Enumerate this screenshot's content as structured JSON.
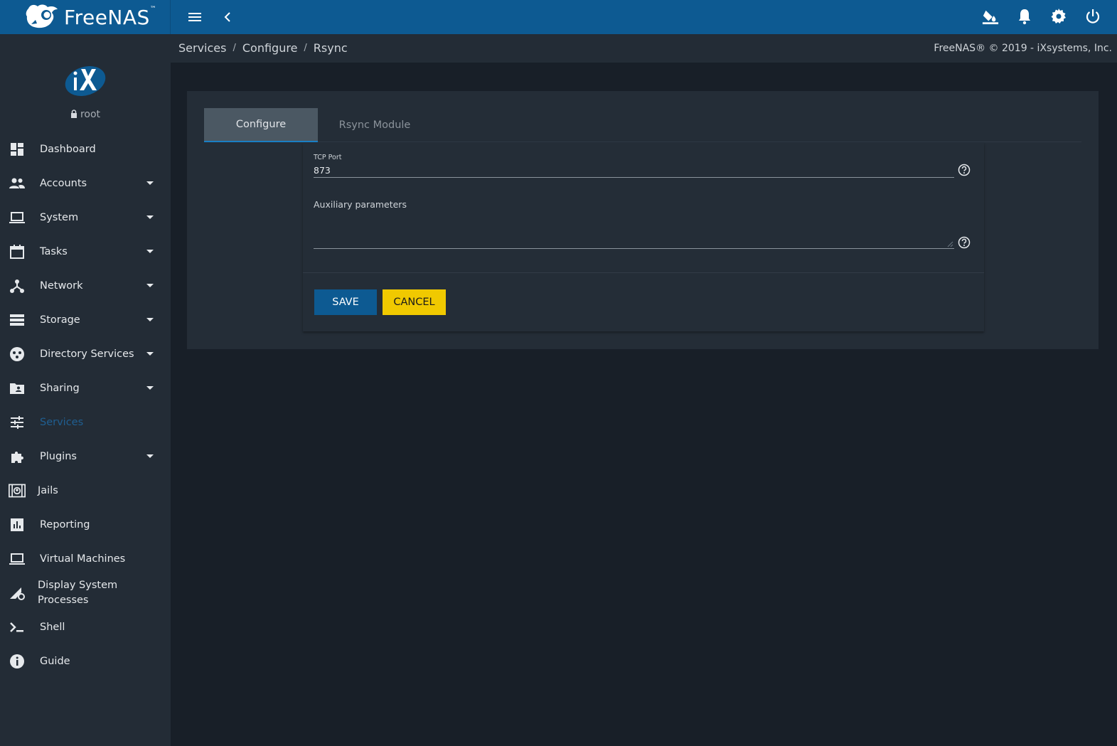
{
  "app": {
    "brand_name": "FreeNAS",
    "brand_tm": "™",
    "user": "root",
    "copyright": "FreeNAS® © 2019 - iXsystems, Inc."
  },
  "breadcrumb": [
    "Services",
    "Configure",
    "Rsync"
  ],
  "breadcrumb_separator": "/",
  "sidebar": {
    "items": [
      {
        "label": "Dashboard",
        "icon": "dashboard-icon",
        "expandable": false
      },
      {
        "label": "Accounts",
        "icon": "people-icon",
        "expandable": true
      },
      {
        "label": "System",
        "icon": "laptop-icon",
        "expandable": true
      },
      {
        "label": "Tasks",
        "icon": "calendar-icon",
        "expandable": true
      },
      {
        "label": "Network",
        "icon": "network-icon",
        "expandable": true
      },
      {
        "label": "Storage",
        "icon": "storage-icon",
        "expandable": true
      },
      {
        "label": "Directory Services",
        "icon": "directory-icon",
        "expandable": true
      },
      {
        "label": "Sharing",
        "icon": "shared-folder-icon",
        "expandable": true
      },
      {
        "label": "Services",
        "icon": "sliders-icon",
        "expandable": false,
        "active": true
      },
      {
        "label": "Plugins",
        "icon": "puzzle-icon",
        "expandable": true
      },
      {
        "label": "Jails",
        "icon": "jail-icon",
        "expandable": false
      },
      {
        "label": "Reporting",
        "icon": "bar-chart-icon",
        "expandable": false
      },
      {
        "label": "Virtual Machines",
        "icon": "laptop-icon",
        "expandable": false
      },
      {
        "label": "Display System Processes",
        "icon": "processes-icon",
        "expandable": false
      },
      {
        "label": "Shell",
        "icon": "terminal-icon",
        "expandable": false
      },
      {
        "label": "Guide",
        "icon": "info-icon",
        "expandable": false
      }
    ]
  },
  "tabs": [
    {
      "label": "Configure",
      "active": true
    },
    {
      "label": "Rsync Module",
      "active": false
    }
  ],
  "form": {
    "tcp_port": {
      "label": "TCP Port",
      "value": "873"
    },
    "aux_params": {
      "label": "Auxiliary parameters",
      "value": ""
    },
    "save_label": "SAVE",
    "cancel_label": "CANCEL"
  },
  "colors": {
    "topbar": "#0d5a92",
    "sidebar": "#232c36",
    "background": "#181f28",
    "save_button": "#0d5a92",
    "cancel_button": "#f0c900",
    "active_nav": "#1f5f92"
  }
}
